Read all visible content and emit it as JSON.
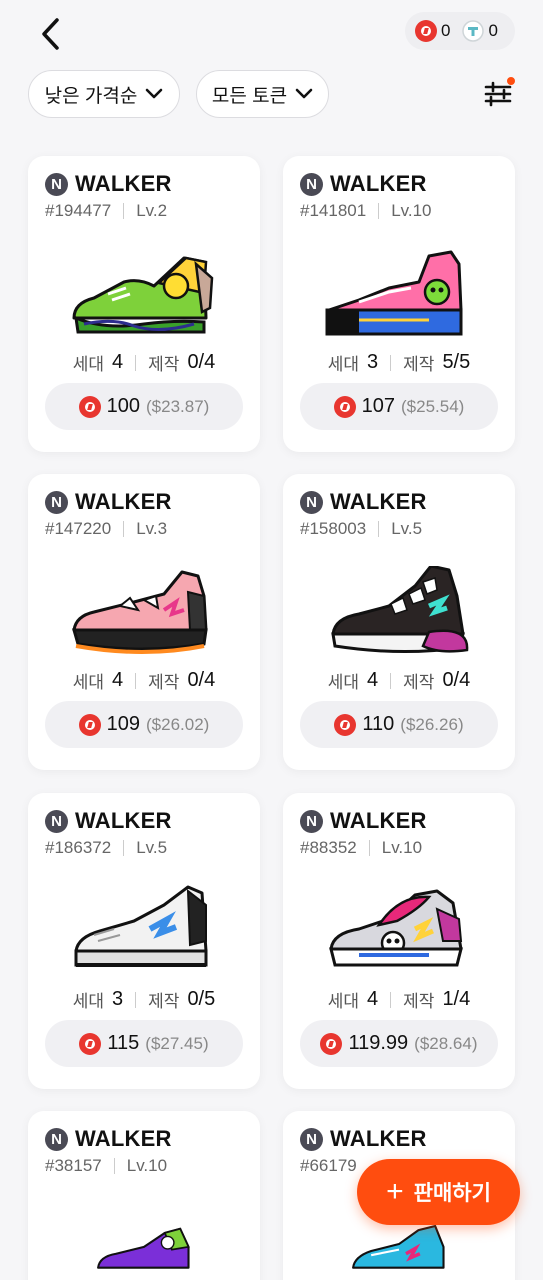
{
  "balances": [
    {
      "icon": "red-coin-icon",
      "value": "0"
    },
    {
      "icon": "teal-token-icon",
      "value": "0"
    }
  ],
  "filters": {
    "sort_label": "낮은 가격순",
    "token_label": "모든 토큰"
  },
  "cards": [
    {
      "kind": "WALKER",
      "id": "#194477",
      "level": "Lv.2",
      "gen_label": "세대",
      "gen": "4",
      "mint_label": "제작",
      "mint": "0/4",
      "price": "100",
      "usd": "($23.87)"
    },
    {
      "kind": "WALKER",
      "id": "#141801",
      "level": "Lv.10",
      "gen_label": "세대",
      "gen": "3",
      "mint_label": "제작",
      "mint": "5/5",
      "price": "107",
      "usd": "($25.54)"
    },
    {
      "kind": "WALKER",
      "id": "#147220",
      "level": "Lv.3",
      "gen_label": "세대",
      "gen": "4",
      "mint_label": "제작",
      "mint": "0/4",
      "price": "109",
      "usd": "($26.02)"
    },
    {
      "kind": "WALKER",
      "id": "#158003",
      "level": "Lv.5",
      "gen_label": "세대",
      "gen": "4",
      "mint_label": "제작",
      "mint": "0/4",
      "price": "110",
      "usd": "($26.26)"
    },
    {
      "kind": "WALKER",
      "id": "#186372",
      "level": "Lv.5",
      "gen_label": "세대",
      "gen": "3",
      "mint_label": "제작",
      "mint": "0/5",
      "price": "115",
      "usd": "($27.45)"
    },
    {
      "kind": "WALKER",
      "id": "#88352",
      "level": "Lv.10",
      "gen_label": "세대",
      "gen": "4",
      "mint_label": "제작",
      "mint": "1/4",
      "price": "119.99",
      "usd": "($28.64)"
    },
    {
      "kind": "WALKER",
      "id": "#38157",
      "level": "Lv.10"
    },
    {
      "kind": "WALKER",
      "id": "#66179",
      "level": ""
    }
  ],
  "fab": {
    "label": "판매하기"
  },
  "colors": {
    "accent": "#ff4d0f",
    "coin": "#e8362f"
  }
}
